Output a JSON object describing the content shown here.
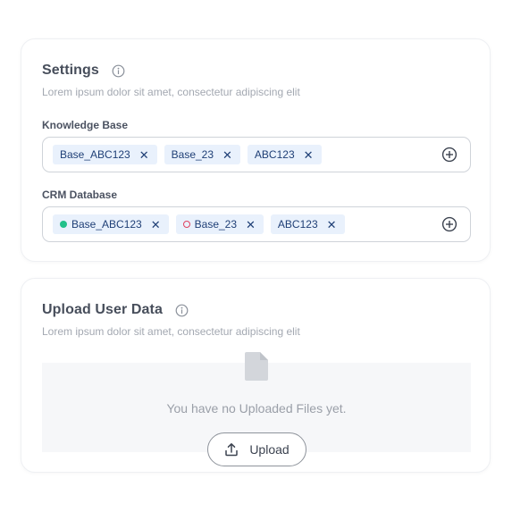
{
  "settings": {
    "title": "Settings",
    "subtitle": "Lorem ipsum dolor sit amet, consectetur adipiscing elit",
    "knowledge_base": {
      "label": "Knowledge Base",
      "chips": [
        "Base_ABC123",
        "Base_23",
        "ABC123"
      ]
    },
    "crm_database": {
      "label": "CRM Database",
      "chips": [
        {
          "label": "Base_ABC123",
          "status": "active"
        },
        {
          "label": "Base_23",
          "status": "inactive"
        },
        {
          "label": "ABC123",
          "status": "none"
        }
      ]
    }
  },
  "upload": {
    "title": "Upload User Data",
    "subtitle": "Lorem ipsum dolor sit amet, consectetur adipiscing elit",
    "empty_text": "You have no Uploaded Files yet.",
    "button_label": "Upload"
  },
  "icons": {
    "info": "info-icon",
    "remove": "close-icon",
    "add": "plus-circle-icon",
    "file": "file-icon",
    "upload": "upload-icon"
  },
  "colors": {
    "chip_bg": "#e9f1fc",
    "chip_text": "#1f3f76",
    "status_active": "#22c08a",
    "status_inactive": "#e0405e"
  }
}
